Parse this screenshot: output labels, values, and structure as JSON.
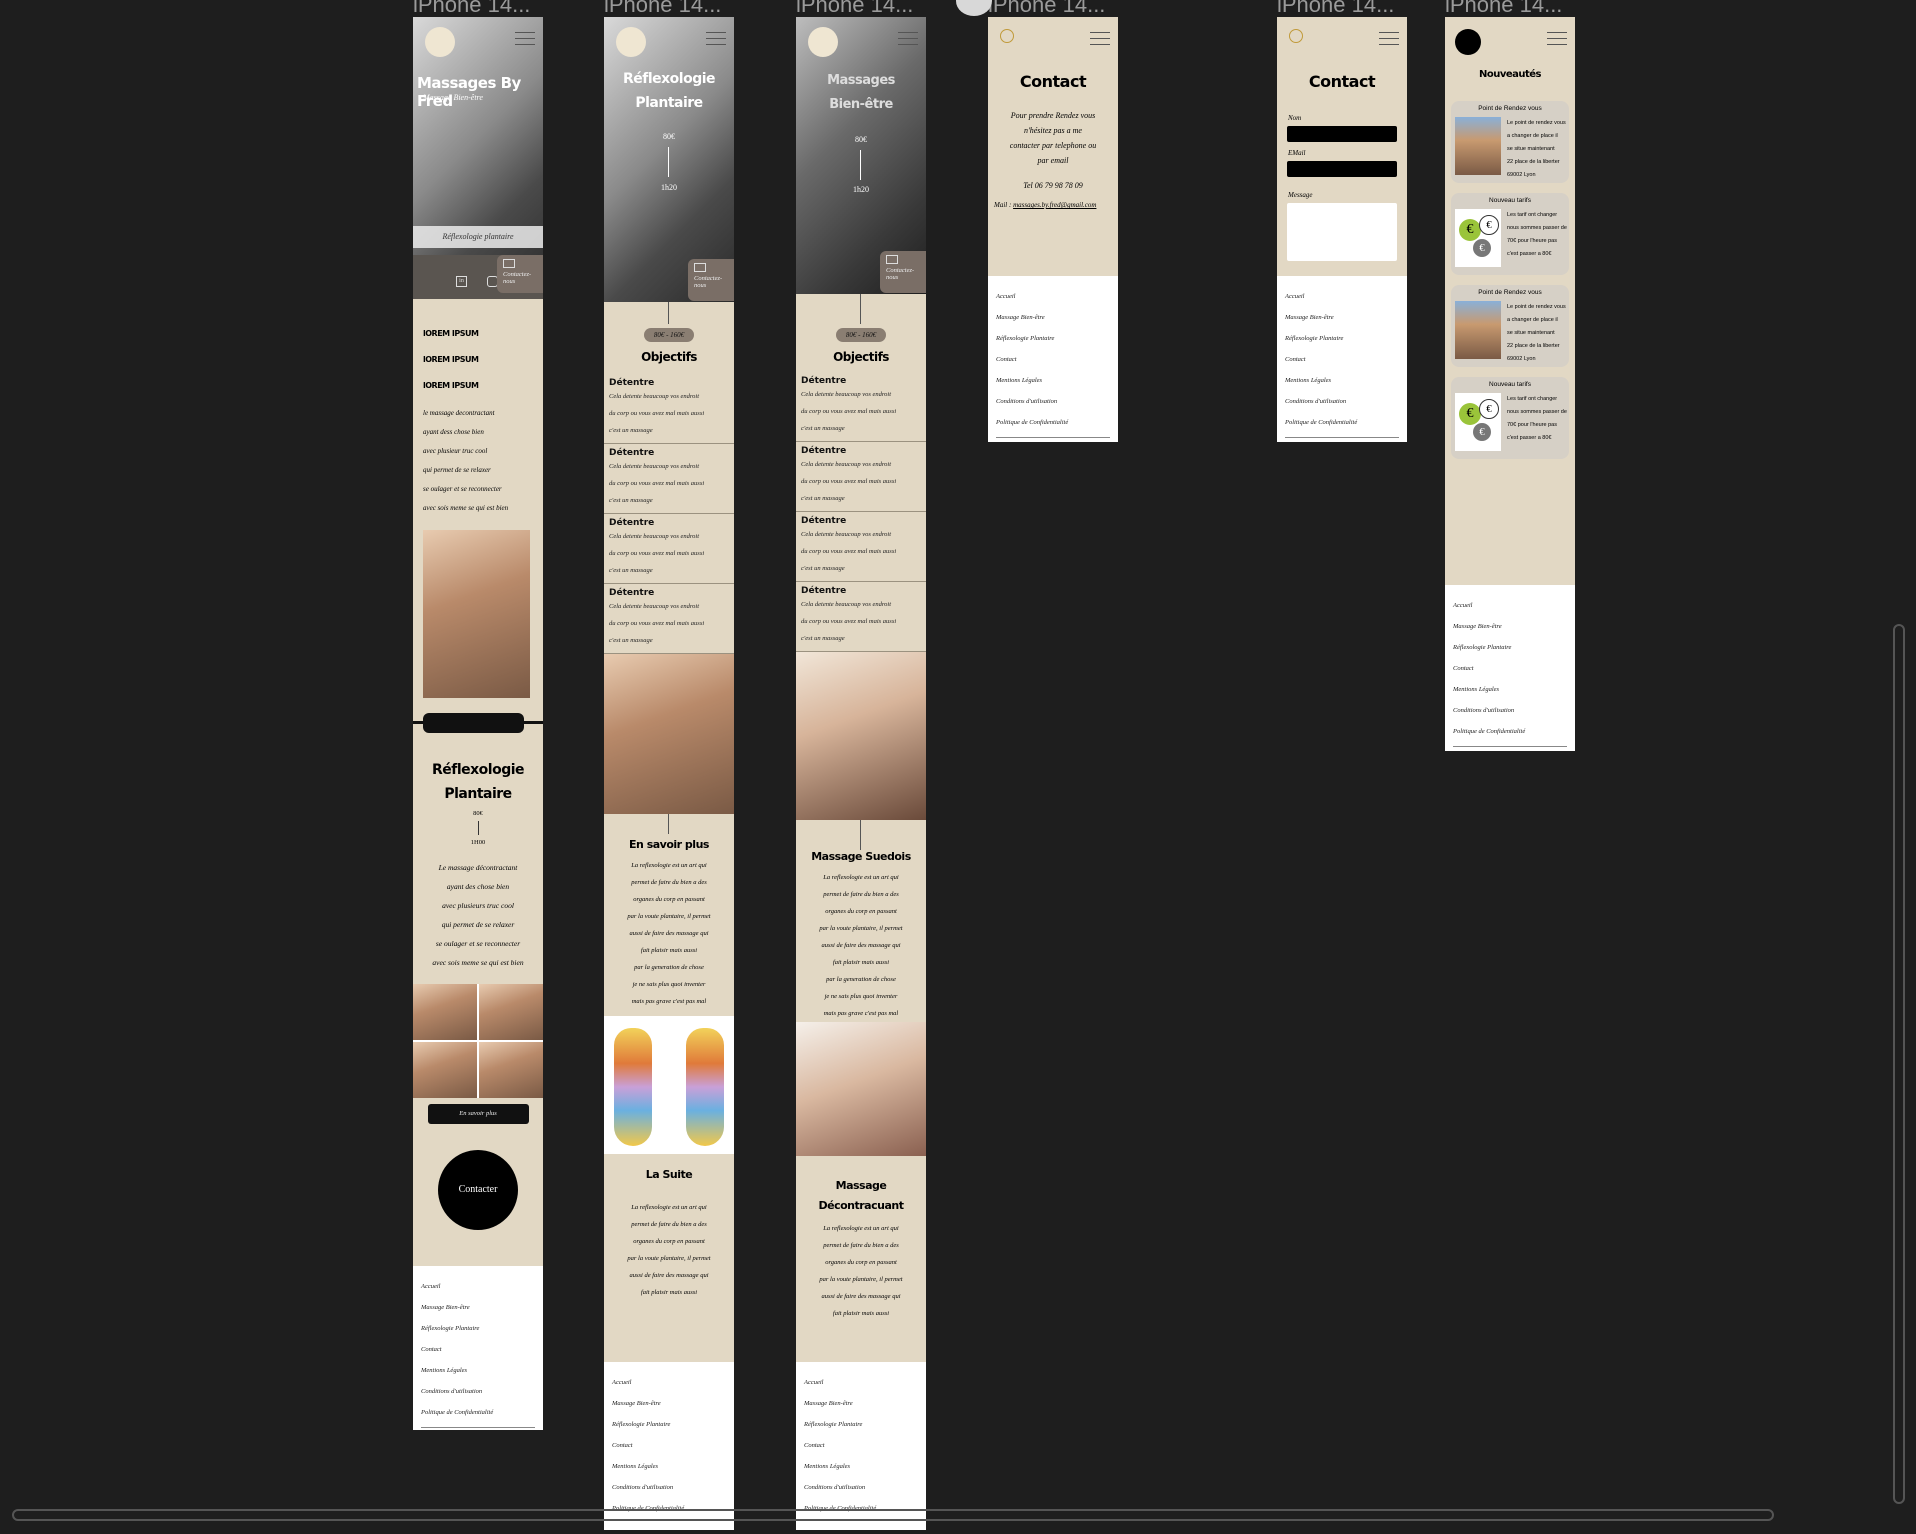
{
  "frames": [
    {
      "title": "iPhone 14..."
    },
    {
      "title": "iPhone 14..."
    },
    {
      "title": "iPhone 14..."
    },
    {
      "title": "iPhone 14..."
    },
    {
      "title": "iPhone 14..."
    },
    {
      "title": "iPhone 14..."
    }
  ],
  "footer": [
    "Accueil",
    "Massage Bien-être",
    "Réflexologie Plantaire",
    "Contact",
    "Mentions Légales",
    "Conditions d'utilisation",
    "Politique de Confidentialité"
  ],
  "f1": {
    "hero_title": "Massages By Fred",
    "hero_sub": "Massage Bien-être",
    "caption": "Réflexologie plantaire",
    "contact_tab": "Contactez-nous",
    "lorem": [
      "lOREM IPSUM",
      "lOREM IPSUM",
      "lOREM IPSUM"
    ],
    "text1": [
      "le massage decontractant",
      "ayant dess chose bien",
      "avec plusieur truc cool",
      "qui permet de se relaxer",
      "se oulager et se reconnecter",
      "avec sois meme se qui est bien"
    ],
    "title2a": "Réflexologie",
    "title2b": "Plantaire",
    "price": "80€",
    "duration": "1H00",
    "text2": [
      "Le massage décontractant",
      "ayant des chose bien",
      "avec plusieurs truc cool",
      "qui permet de se relaxer",
      "se oulager et se reconnecter",
      "avec sois meme se qui est bien"
    ],
    "more_btn": "En savoir plus",
    "contact_btn": "Contacter"
  },
  "f2": {
    "title_a": "Réflexologie",
    "title_b": "Plantaire",
    "price": "80€",
    "duration": "1h20",
    "contact_tab": "Contactez-nous",
    "pill": "80€ - 160€",
    "obj_title": "Objectifs",
    "obj_block": {
      "title": "Détentre",
      "lines": [
        "Cela detente beaucoup vos endroit",
        "du corp ou vous avez mal mais aussi",
        "c'est un massage"
      ]
    },
    "sec1": "En savoir plus",
    "sec1_lines": [
      "La reflexologie est un art qui",
      "permet de faire du bien a des",
      "organes du corp en passant",
      "par la voute plantaire, il permet",
      "aussi de faire des massage qui",
      "fait plaisir mais aussi",
      "par la generation de chose",
      "je ne sais plus quoi inventer",
      "mais pas grave c'est pas mal"
    ],
    "sec2": "La Suite",
    "sec2_lines": [
      "La reflexologie est un art qui",
      "permet de faire du bien a des",
      "organes du corp en passant",
      "par la voute plantaire, il permet",
      "aussi de faire des massage qui",
      "fait plaisir mais aussi"
    ]
  },
  "f3": {
    "title_a": "Massages",
    "title_b": "Bien-être",
    "price": "80€",
    "duration": "1h20",
    "contact_tab": "Contactez-nous",
    "pill": "80€ - 160€",
    "obj_title": "Objectifs",
    "sec1": "Massage Suedois",
    "sec2a": "Massage",
    "sec2b": "Décontracuant"
  },
  "f4": {
    "title": "Contact",
    "lines": [
      "Pour prendre Rendez vous",
      "n'hésitez pas a me",
      "contacter par telephone ou",
      "par email"
    ],
    "tel": "Tel 06 79 98 78 09",
    "mail_label": "Mail :",
    "mail": "massages.by.fred@gmail.com"
  },
  "f5": {
    "title": "Contact",
    "nom": "Nom",
    "email": "EMail",
    "message": "Message"
  },
  "f6": {
    "title": "Nouveautés",
    "cards": [
      {
        "title": "Point de Rendez vous",
        "lines": [
          "Le point de rendez vous",
          "a changer de place il",
          "se situe maintenant",
          "22 place de la liberter",
          "69002 Lyon"
        ],
        "img": "building"
      },
      {
        "title": "Nouveau tarifs",
        "lines": [
          "Les tarif ont changer",
          "nous sommes passer de",
          "70€ pour l'heure pas",
          "c'est passer a 80€"
        ],
        "img": "euro"
      },
      {
        "title": "Point de Rendez vous",
        "lines": [
          "Le point de rendez vous",
          "a changer de place il",
          "se situe maintenant",
          "22 place de la liberter",
          "69002 Lyon"
        ],
        "img": "building"
      },
      {
        "title": "Nouveau tarifs",
        "lines": [
          "Les tarif ont changer",
          "nous sommes passer de",
          "70€ pour l'heure pas",
          "c'est passer a 80€"
        ],
        "img": "euro"
      }
    ]
  }
}
